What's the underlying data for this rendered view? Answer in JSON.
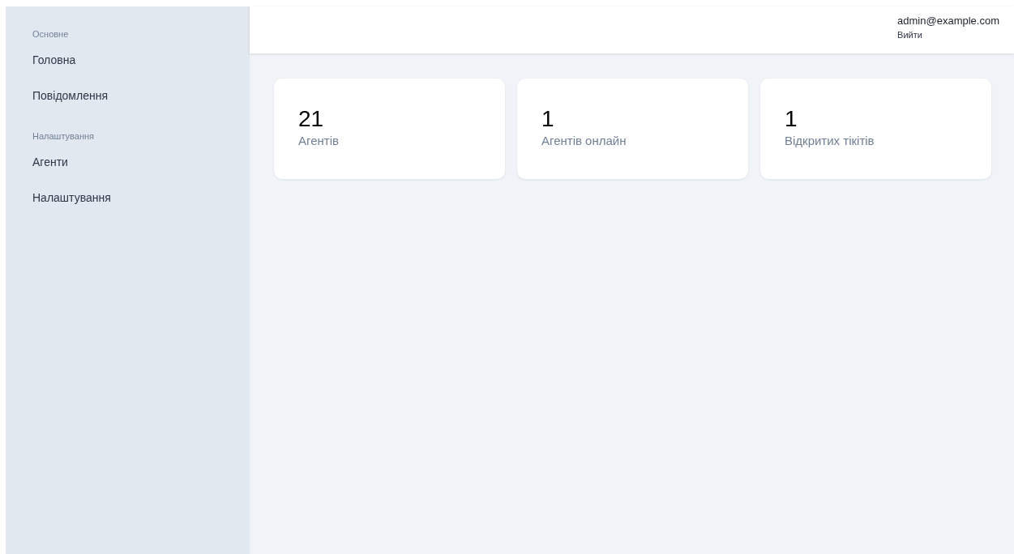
{
  "sidebar": {
    "sections": [
      {
        "title": "Основне",
        "items": [
          {
            "label": "Головна"
          },
          {
            "label": "Повідомлення"
          }
        ]
      },
      {
        "title": "Налаштування",
        "items": [
          {
            "label": "Агенти"
          },
          {
            "label": "Налаштування"
          }
        ]
      }
    ]
  },
  "header": {
    "user_email": "admin@example.com",
    "logout": "Вийти"
  },
  "stats": [
    {
      "value": "21",
      "label": "Агентів"
    },
    {
      "value": "1",
      "label": "Агентів онлайн"
    },
    {
      "value": "1",
      "label": "Відкритих тікітів"
    }
  ]
}
